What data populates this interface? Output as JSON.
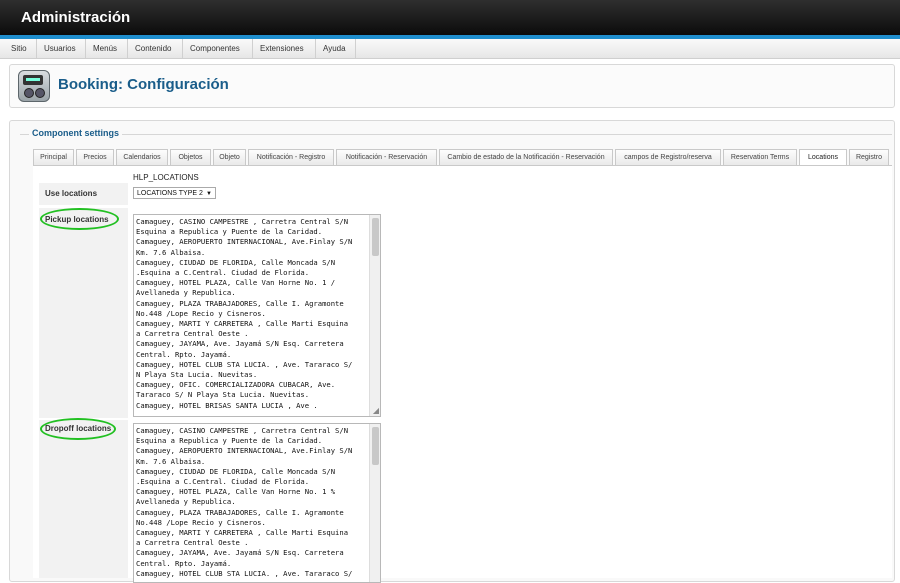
{
  "app": {
    "title": "Administración"
  },
  "menu": [
    "Sitio",
    "Usuarios",
    "Menús",
    "Contenido",
    "Componentes",
    "Extensiones",
    "Ayuda"
  ],
  "page": {
    "title": "Booking: Configuración"
  },
  "settings": {
    "legend": "Component settings"
  },
  "tabs": [
    "Principal",
    "Precios",
    "Calendarios",
    "Objetos",
    "Objeto",
    "Notificación - Registro",
    "Notificación - Reservación",
    "Cambio de estado de la Notificación - Reservación",
    "campos de Registro/reserva",
    "Reservation Terms",
    "Locations",
    "Registro"
  ],
  "active_tab": "Locations",
  "form": {
    "help_key": "HLP_LOCATIONS",
    "use_locations_label": "Use locations",
    "use_locations_value": "LOCATIONS TYPE 2",
    "pickup_label": "Pickup locations",
    "dropoff_label": "Dropoff locations",
    "pickup_text": "Camaguey, CASINO CAMPESTRE , Carretra Central S/N\nEsquina a Republica y Puente de la Caridad.\nCamaguey, AEROPUERTO INTERNACIONAL, Ave.Finlay S/N\nKm. 7.6 Albaisa.\nCamaguey, CIUDAD DE FLORIDA, Calle Moncada S/N\n.Esquina a C.Central. Ciudad de Florida.\nCamaguey, HOTEL PLAZA, Calle Van Horne No. 1 /\nAvellaneda y Republica.\nCamaguey, PLAZA TRABAJADORES, Calle I. Agramonte\nNo.448 /Lope Recio y Cisneros.\nCamaguey, MARTI Y CARRETERA , Calle Marti Esquina\na Carretra Central Oeste .\nCamaguey, JAYAMA, Ave. Jayamá S/N Esq. Carretera\nCentral. Rpto. Jayamá.\nCamaguey, HOTEL CLUB STA LUCIA. , Ave. Tararaco S/\nN Playa Sta Lucia. Nuevitas.\nCamaguey, OFIC. COMERCIALIZADORA CUBACAR, Ave.\nTararaco S/ N Playa Sta Lucia. Nuevitas.\nCamaguey, HOTEL BRISAS SANTA LUCIA , Ave .",
    "dropoff_text": "Camaguey, CASINO CAMPESTRE , Carretra Central S/N\nEsquina a Republica y Puente de la Caridad.\nCamaguey, AEROPUERTO INTERNACIONAL, Ave.Finlay S/N\nKm. 7.6 Albaisa.\nCamaguey, CIUDAD DE FLORIDA, Calle Moncada S/N\n.Esquina a C.Central. Ciudad de Florida.\nCamaguey, HOTEL PLAZA, Calle Van Horne No. 1 %\nAvellaneda y Republica.\nCamaguey, PLAZA TRABAJADORES, Calle I. Agramonte\nNo.448 /Lope Recio y Cisneros.\nCamaguey, MARTI Y CARRETERA , Calle Marti Esquina\na Carretra Central Oeste .\nCamaguey, JAYAMA, Ave. Jayamá S/N Esq. Carretera\nCentral. Rpto. Jayamá.\nCamaguey, HOTEL CLUB STA LUCIA. , Ave. Tararaco S/"
  },
  "colors": {
    "accent_blue": "#1f8ecd",
    "title_blue": "#1a5d8a",
    "annotation_green": "#22c022"
  }
}
